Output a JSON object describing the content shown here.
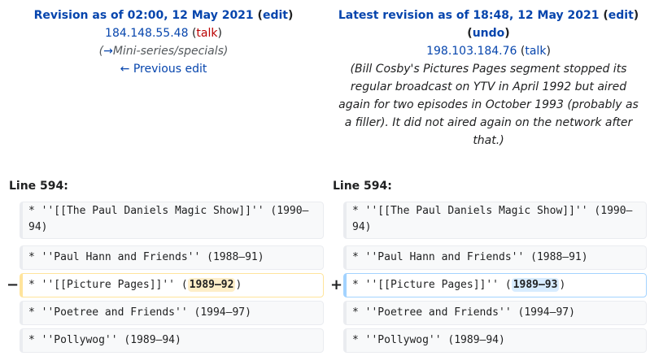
{
  "left_header": {
    "title_prefix": "Revision as of 02:00, 12 May 2021",
    "edit_label": "edit",
    "user_ip": "184.148.55.48",
    "talk_label": "talk",
    "comment_arrow": "→",
    "comment_section": "Mini-series/specials",
    "previous_edit": "← Previous edit"
  },
  "right_header": {
    "title_prefix": "Latest revision as of 18:48, 12 May 2021",
    "edit_label": "edit",
    "undo_label": "undo",
    "user_ip": "198.103.184.76",
    "talk_label": "talk",
    "comment": "Bill Cosby's Pictures Pages segment stopped its regular broadcast on YTV in April 1992 but aired again for two episodes in October 1993 (probably as a filler). It did not aired again on the network after that."
  },
  "line_label_left": "Line 594:",
  "line_label_right": "Line 594:",
  "markers": {
    "deleted": "−",
    "added": "+"
  },
  "diff_left": {
    "row1": "* ''[[The Paul Daniels Magic Show]]'' (1990–94)",
    "row2": "* ''Paul Hann and Friends'' (1988–91)",
    "row3_prefix": "* ''[[Picture Pages]]'' (",
    "row3_changed": "1989–92",
    "row3_suffix": ")",
    "row4": "* ''Poetree and Friends'' (1994–97)",
    "row5": "* ''Pollywog'' (1989–94)"
  },
  "diff_right": {
    "row1": "* ''[[The Paul Daniels Magic Show]]'' (1990–94)",
    "row2": "* ''Paul Hann and Friends'' (1988–91)",
    "row3_prefix": "* ''[[Picture Pages]]'' (",
    "row3_changed": "1989–93",
    "row3_suffix": ")",
    "row4": "* ''Poetree and Friends'' (1994–97)",
    "row5": "* ''Pollywog'' (1989–94)"
  },
  "colors": {
    "link": "#0645ad",
    "redlink": "#ba0000",
    "deleted_border": "#ffe49c",
    "deleted_highlight": "#feeec8",
    "added_border": "#a3d3ff",
    "added_highlight": "#d8ecff",
    "context_bg": "#f8f9fa"
  }
}
